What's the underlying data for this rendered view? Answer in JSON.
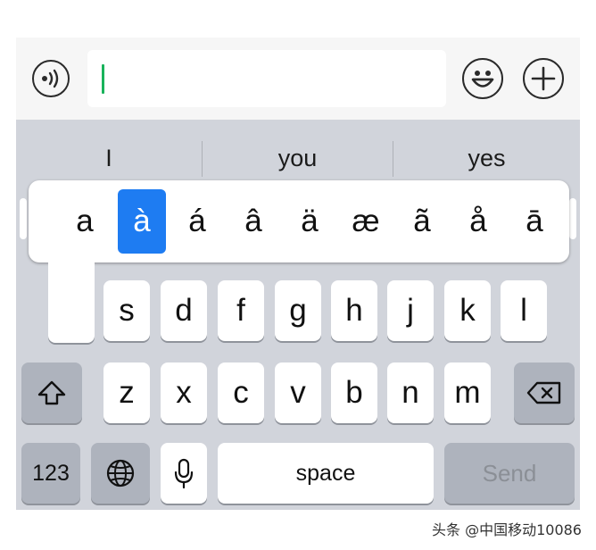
{
  "input_bar": {
    "voice_icon": "voice-icon",
    "emoji_icon": "smiley-icon",
    "plus_icon": "plus-icon",
    "text_value": "",
    "cursor_color": "#19b35b"
  },
  "suggestions": [
    "I",
    "you",
    "yes"
  ],
  "accent_popup": {
    "chars": [
      "a",
      "à",
      "á",
      "â",
      "ä",
      "æ",
      "ã",
      "å",
      "ā"
    ],
    "selected": "à",
    "selected_color": "#1e7cf2"
  },
  "keyboard": {
    "row2": [
      "s",
      "d",
      "f",
      "g",
      "h",
      "j",
      "k",
      "l"
    ],
    "row3": [
      "z",
      "x",
      "c",
      "v",
      "b",
      "n",
      "m"
    ],
    "shift_icon": "shift-icon",
    "backspace_icon": "backspace-icon",
    "numbers_label": "123",
    "globe_icon": "globe-icon",
    "mic_icon": "microphone-icon",
    "space_label": "space",
    "send_label": "Send"
  },
  "watermark": "头条 @中国移动10086"
}
